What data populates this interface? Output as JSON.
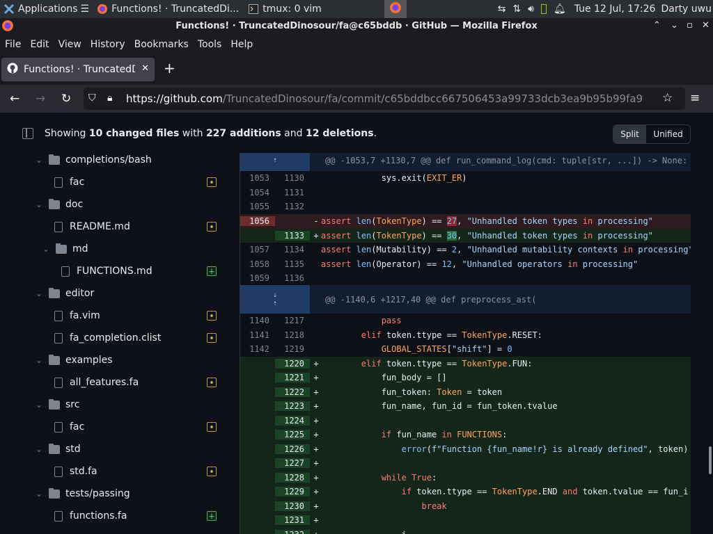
{
  "taskbar": {
    "applications": "Applications",
    "task_firefox": "Functions! · TruncatedDi...",
    "task_tmux": "tmux: 0 vim",
    "clock": "Tue 12 Jul, 17:26",
    "user": "Darty uwu"
  },
  "window": {
    "title": "Functions! · TruncatedDinosour/fa@c65bddb · GitHub — Mozilla Firefox"
  },
  "menu": [
    "File",
    "Edit",
    "View",
    "History",
    "Bookmarks",
    "Tools",
    "Help"
  ],
  "tab": {
    "title": "Functions! · TruncatedDinosaur"
  },
  "url": {
    "domain": "https://github.com",
    "path": "/TruncatedDinosour/fa/commit/c65bddbcc667506453a99733dcb3ea9b95b99fa9"
  },
  "summary": {
    "prefix": "Showing ",
    "files": "10 changed files",
    "mid": " with ",
    "additions": "227 additions",
    "and": " and ",
    "deletions": "12 deletions",
    "end": "."
  },
  "view_toggle": {
    "split": "Split",
    "unified": "Unified"
  },
  "tree": [
    {
      "type": "folder",
      "label": "completions/bash",
      "depth": 0
    },
    {
      "type": "file",
      "label": "fac",
      "depth": 1,
      "status": "modified"
    },
    {
      "type": "folder",
      "label": "doc",
      "depth": 0
    },
    {
      "type": "file",
      "label": "README.md",
      "depth": 1,
      "status": "modified"
    },
    {
      "type": "folder",
      "label": "md",
      "depth": 1
    },
    {
      "type": "file",
      "label": "FUNCTIONS.md",
      "depth": 2,
      "status": "added"
    },
    {
      "type": "folder",
      "label": "editor",
      "depth": 0
    },
    {
      "type": "file",
      "label": "fa.vim",
      "depth": 1,
      "status": "modified"
    },
    {
      "type": "file",
      "label": "fa_completion.clist",
      "depth": 1,
      "status": "modified"
    },
    {
      "type": "folder",
      "label": "examples",
      "depth": 0
    },
    {
      "type": "file",
      "label": "all_features.fa",
      "depth": 1,
      "status": "modified"
    },
    {
      "type": "folder",
      "label": "src",
      "depth": 0
    },
    {
      "type": "file",
      "label": "fac",
      "depth": 1,
      "status": "modified"
    },
    {
      "type": "folder",
      "label": "std",
      "depth": 0
    },
    {
      "type": "file",
      "label": "std.fa",
      "depth": 1,
      "status": "modified"
    },
    {
      "type": "folder",
      "label": "tests/passing",
      "depth": 0
    },
    {
      "type": "file",
      "label": "functions.fa",
      "depth": 1,
      "status": "added"
    }
  ],
  "hunks": [
    "@@ -1053,7 +1130,7 @@ def run_command_log(cmd: tuple[str, ...]) -> None:",
    "@@ -1140,6 +1217,40 @@ def preprocess_ast("
  ],
  "diff_lines": [
    {
      "kind": "ctx",
      "old": "1053",
      "new": "1130",
      "sign": "",
      "code": "            sys.exit(EXIT_ER)"
    },
    {
      "kind": "ctx",
      "old": "1054",
      "new": "1131",
      "sign": "",
      "code": ""
    },
    {
      "kind": "ctx",
      "old": "1055",
      "new": "1132",
      "sign": "",
      "code": ""
    },
    {
      "kind": "del",
      "old": "1056",
      "new": "",
      "sign": "-",
      "code": "assert len(TokenType) == 27, \"Unhandled token types in processing\""
    },
    {
      "kind": "add",
      "old": "",
      "new": "1133",
      "sign": "+",
      "code": "assert len(TokenType) == 30, \"Unhandled token types in processing\""
    },
    {
      "kind": "ctx",
      "old": "1057",
      "new": "1134",
      "sign": "",
      "code": "assert len(Mutability) == 2, \"Unhandled mutability contexts in processing\""
    },
    {
      "kind": "ctx",
      "old": "1058",
      "new": "1135",
      "sign": "",
      "code": "assert len(Operator) == 12, \"Unhandled operators in processing\""
    },
    {
      "kind": "ctx",
      "old": "1059",
      "new": "1136",
      "sign": "",
      "code": ""
    },
    {
      "kind": "ctx",
      "old": "1140",
      "new": "1217",
      "sign": "",
      "code": "            pass"
    },
    {
      "kind": "ctx",
      "old": "1141",
      "new": "1218",
      "sign": "",
      "code": "        elif token.ttype == TokenType.RESET:"
    },
    {
      "kind": "ctx",
      "old": "1142",
      "new": "1219",
      "sign": "",
      "code": "            GLOBAL_STATES[\"shift\"] = 0"
    },
    {
      "kind": "add",
      "old": "",
      "new": "1220",
      "sign": "+",
      "code": "        elif token.ttype == TokenType.FUN:"
    },
    {
      "kind": "add",
      "old": "",
      "new": "1221",
      "sign": "+",
      "code": "            fun_body = []"
    },
    {
      "kind": "add",
      "old": "",
      "new": "1222",
      "sign": "+",
      "code": "            fun_token: Token = token"
    },
    {
      "kind": "add",
      "old": "",
      "new": "1223",
      "sign": "+",
      "code": "            fun_name, fun_id = fun_token.tvalue"
    },
    {
      "kind": "add",
      "old": "",
      "new": "1224",
      "sign": "+",
      "code": ""
    },
    {
      "kind": "add",
      "old": "",
      "new": "1225",
      "sign": "+",
      "code": "            if fun_name in FUNCTIONS:"
    },
    {
      "kind": "add",
      "old": "",
      "new": "1226",
      "sign": "+",
      "code": "                error(f\"Function {fun_name!r} is already defined\", token)"
    },
    {
      "kind": "add",
      "old": "",
      "new": "1227",
      "sign": "+",
      "code": ""
    },
    {
      "kind": "add",
      "old": "",
      "new": "1228",
      "sign": "+",
      "code": "            while True:"
    },
    {
      "kind": "add",
      "old": "",
      "new": "1229",
      "sign": "+",
      "code": "                if token.ttype == TokenType.END and token.tvalue == fun_i"
    },
    {
      "kind": "add",
      "old": "",
      "new": "1230",
      "sign": "+",
      "code": "                    break"
    },
    {
      "kind": "add",
      "old": "",
      "new": "1231",
      "sign": "+",
      "code": ""
    },
    {
      "kind": "add",
      "old": "",
      "new": "1232",
      "sign": "+",
      "code": "                i"
    }
  ]
}
